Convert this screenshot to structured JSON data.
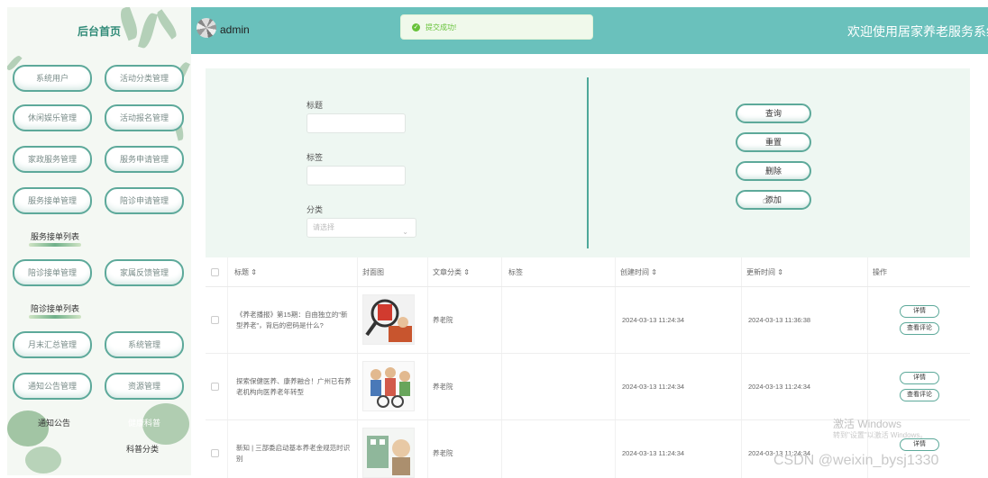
{
  "header": {
    "username": "admin",
    "welcome": "欢迎使用居家养老服务系统",
    "toast": "提交成功!"
  },
  "sidebar": {
    "title": "后台首页",
    "menu": [
      "系统用户",
      "活动分类管理",
      "休闲娱乐管理",
      "活动报名管理",
      "家政服务管理",
      "服务申请管理",
      "服务接单管理",
      "陪诊申请管理",
      "陪诊接单管理",
      "家属反馈管理",
      "月末汇总管理",
      "系统管理",
      "通知公告管理",
      "资源管理"
    ],
    "subs": [
      "服务接单列表",
      "陪诊接单列表",
      "通知公告",
      "健康科普",
      "科普分类"
    ]
  },
  "search": {
    "title_label": "标题",
    "tag_label": "标签",
    "category_label": "分类",
    "category_placeholder": "请选择",
    "buttons": [
      "查询",
      "重置",
      "删除",
      "添加"
    ]
  },
  "table": {
    "headers": [
      "标题",
      "封面图",
      "文章分类",
      "标签",
      "创建时间",
      "更新时间",
      "操作"
    ],
    "rows": [
      {
        "title": "《养老播报》第15期：自由独立的\"新型养老\"，背后的密码是什么?",
        "category": "养老院",
        "tag": "",
        "created": "2024-03-13 11:24:34",
        "updated": "2024-03-13 11:36:38"
      },
      {
        "title": "探索保健医养、康养融合！广州已有养老机构向医养老年转型",
        "category": "养老院",
        "tag": "",
        "created": "2024-03-13 11:24:34",
        "updated": "2024-03-13 11:24:34"
      },
      {
        "title": "新知 | 三部委启动基本养老金规范时识别",
        "category": "养老院",
        "tag": "",
        "created": "2024-03-13 11:24:34",
        "updated": "2024-03-13 11:24:34"
      }
    ],
    "row_actions": [
      "详情",
      "查看评论"
    ]
  },
  "overlay": {
    "activate_windows": "激活 Windows",
    "activate_hint": "转到\"设置\"以激活 Windows。",
    "csdn": "CSDN @weixin_bysj1330"
  },
  "colors": {
    "accent": "#6ac1bc",
    "border": "#5da99a",
    "success": "#67c23a"
  }
}
